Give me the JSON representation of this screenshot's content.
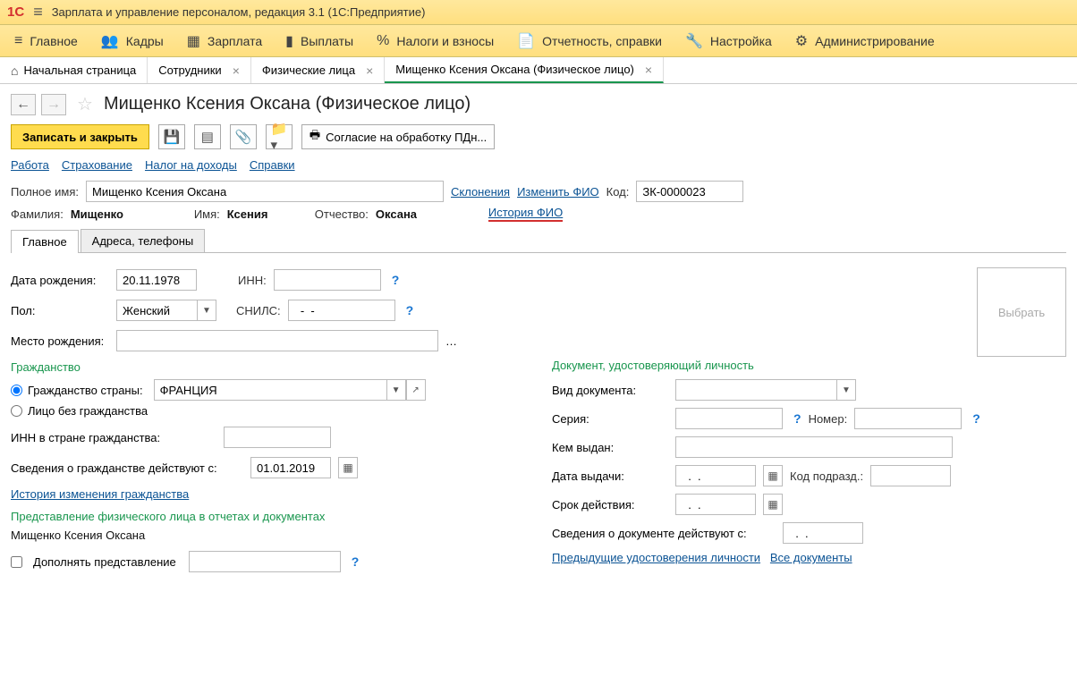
{
  "titlebar": {
    "app": "Зарплата и управление персоналом, редакция 3.1  (1С:Предприятие)"
  },
  "menu": [
    {
      "icon": "≡",
      "label": "Главное"
    },
    {
      "icon": "👥",
      "label": "Кадры"
    },
    {
      "icon": "▦",
      "label": "Зарплата"
    },
    {
      "icon": "▮",
      "label": "Выплаты"
    },
    {
      "icon": "%",
      "label": "Налоги и взносы"
    },
    {
      "icon": "📄",
      "label": "Отчетность, справки"
    },
    {
      "icon": "🔧",
      "label": "Настройка"
    },
    {
      "icon": "⚙",
      "label": "Администрирование"
    }
  ],
  "tabs": [
    {
      "label": "Начальная страница",
      "home": true
    },
    {
      "label": "Сотрудники",
      "close": true
    },
    {
      "label": "Физические лица",
      "close": true
    },
    {
      "label": "Мищенко Ксения Оксана (Физическое лицо)",
      "close": true,
      "active": true
    }
  ],
  "page": {
    "title": "Мищенко Ксения Оксана (Физическое лицо)",
    "save_close": "Записать и закрыть",
    "consent": "Согласие на обработку ПДн..."
  },
  "links": {
    "work": "Работа",
    "insurance": "Страхование",
    "tax": "Налог на доходы",
    "refs": "Справки"
  },
  "form": {
    "fullname_lbl": "Полное имя:",
    "fullname": "Мищенко Ксения Оксана",
    "decl": "Склонения",
    "change": "Изменить ФИО",
    "code_lbl": "Код:",
    "code": "ЗК-0000023",
    "surname_lbl": "Фамилия:",
    "surname": "Мищенко",
    "name_lbl": "Имя:",
    "name": "Ксения",
    "patr_lbl": "Отчество:",
    "patr": "Оксана",
    "history": "История ФИО"
  },
  "tabs2": {
    "main": "Главное",
    "addr": "Адреса, телефоны"
  },
  "main": {
    "dob_lbl": "Дата рождения:",
    "dob": "20.11.1978",
    "inn_lbl": "ИНН:",
    "sex_lbl": "Пол:",
    "sex": "Женский",
    "snils_lbl": "СНИЛС:",
    "snils": "  -  -",
    "pob_lbl": "Место рождения:",
    "citiz": "Гражданство",
    "citiz_country_lbl": "Гражданство страны:",
    "citiz_country": "ФРАНЦИЯ",
    "stateless": "Лицо без гражданства",
    "inn_foreign": "ИНН в стране гражданства:",
    "citiz_from_lbl": "Сведения о гражданстве действуют с:",
    "citiz_from": "01.01.2019",
    "citiz_hist": "История изменения гражданства",
    "repr_title": "Представление физического лица в отчетах и документах",
    "repr_val": "Мищенко Ксения Оксана",
    "repr_add": "Дополнять представление"
  },
  "doc": {
    "title": "Документ, удостоверяющий личность",
    "type_lbl": "Вид документа:",
    "series_lbl": "Серия:",
    "number_lbl": "Номер:",
    "issued_lbl": "Кем выдан:",
    "date_lbl": "Дата выдачи:",
    "date": "  .  .",
    "subdiv_lbl": "Код подразд.:",
    "valid_lbl": "Срок действия:",
    "valid": "  .  .",
    "from_lbl": "Сведения о документе действуют с:",
    "from": "  .  .",
    "prev": "Предыдущие удостоверения личности",
    "all": "Все документы"
  },
  "photo": "Выбрать"
}
